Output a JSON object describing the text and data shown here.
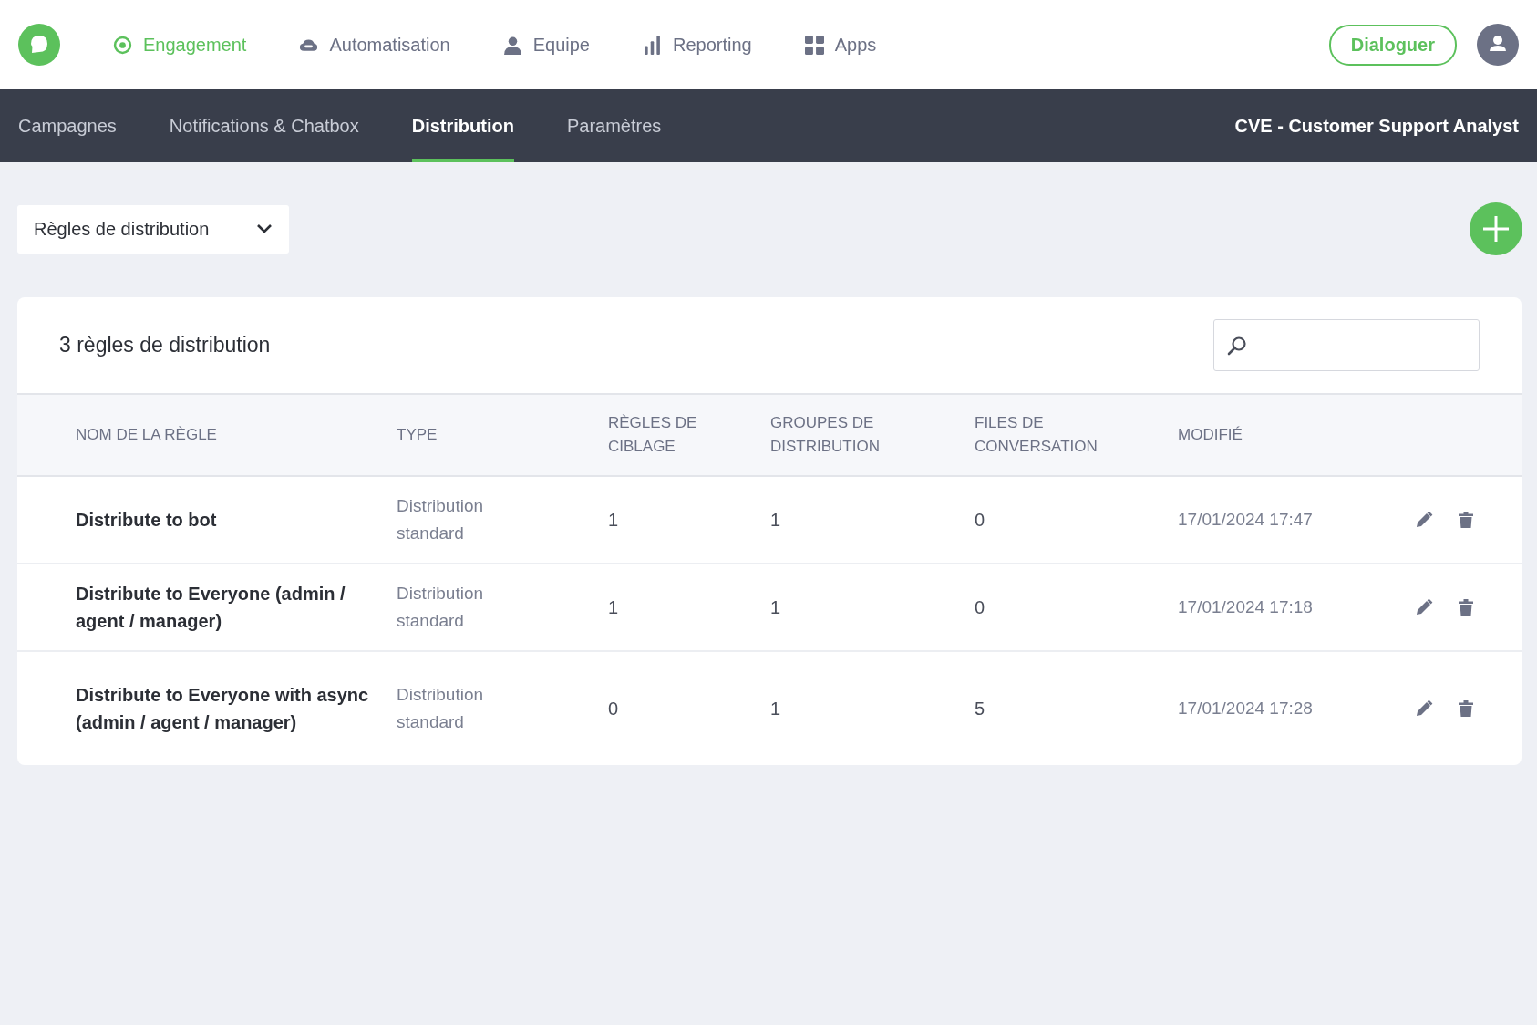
{
  "top_nav": {
    "items": [
      {
        "label": "Engagement",
        "kind": "target",
        "selected": true
      },
      {
        "label": "Automatisation",
        "kind": "cloud",
        "selected": false
      },
      {
        "label": "Equipe",
        "kind": "person",
        "selected": false
      },
      {
        "label": "Reporting",
        "kind": "bars",
        "selected": false
      },
      {
        "label": "Apps",
        "kind": "grid",
        "selected": false
      }
    ],
    "action_button": "Dialoguer"
  },
  "sub_nav": {
    "tabs": [
      {
        "label": "Campagnes",
        "selected": false
      },
      {
        "label": "Notifications & Chatbox",
        "selected": false
      },
      {
        "label": "Distribution",
        "selected": true
      },
      {
        "label": "Paramètres",
        "selected": false
      }
    ],
    "account": "CVE - Customer Support Analyst"
  },
  "view_select": {
    "value": "Règles de distribution"
  },
  "table_card": {
    "title": "3 règles de distribution",
    "columns": [
      "NOM DE LA RÈGLE",
      "TYPE",
      "RÈGLES DE CIBLAGE",
      "GROUPES DE DISTRIBUTION",
      "FILES DE CONVERSATION",
      "MODIFIÉ"
    ],
    "rows": [
      {
        "name": "Distribute to bot",
        "type": "Distribution standard",
        "targeting_rules": "1",
        "distribution_groups": "1",
        "conversation_queues": "0",
        "modified": "17/01/2024 17:47"
      },
      {
        "name": "Distribute to Everyone (admin / agent / manager)",
        "type": "Distribution standard",
        "targeting_rules": "1",
        "distribution_groups": "1",
        "conversation_queues": "0",
        "modified": "17/01/2024 17:18"
      },
      {
        "name": "Distribute to Everyone with async (admin / agent / manager)",
        "type": "Distribution standard",
        "targeting_rules": "0",
        "distribution_groups": "1",
        "conversation_queues": "5",
        "modified": "17/01/2024 17:28"
      }
    ]
  }
}
